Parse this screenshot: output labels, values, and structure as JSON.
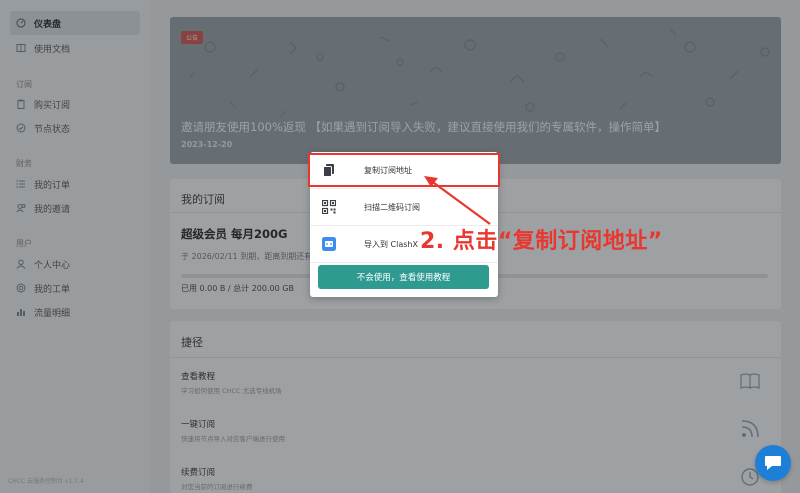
{
  "sidebar": {
    "items": [
      {
        "label": "仪表盘",
        "icon": "dashboard-icon",
        "active": true
      },
      {
        "label": "使用文档",
        "icon": "book-icon"
      },
      {
        "label": "购买订阅",
        "icon": "clipboard-icon"
      },
      {
        "label": "节点状态",
        "icon": "check-circle-icon"
      },
      {
        "label": "我的订单",
        "icon": "list-icon"
      },
      {
        "label": "我的邀请",
        "icon": "users-icon"
      },
      {
        "label": "个人中心",
        "icon": "user-icon"
      },
      {
        "label": "我的工单",
        "icon": "support-icon"
      },
      {
        "label": "流量明细",
        "icon": "bar-chart-icon"
      }
    ],
    "groups": {
      "subscribe": "订阅",
      "finance": "财务",
      "user": "用户"
    },
    "version": "CHCC 云服务控制台 v1.7.4"
  },
  "notice": {
    "tag": "公告",
    "title": "邀请朋友使用100%返现 【如果遇到订阅导入失败，建议直接使用我们的专属软件，操作简单】",
    "date": "2023-12-20"
  },
  "subscription": {
    "header": "我的订阅",
    "plan": "超级会员 每月200G",
    "expire_text": "于 2026/02/11 到期，距离到期还有 778 天。",
    "usage_text": "已用 0.00 B / 总计 200.00 GB",
    "usage_fraction": 0.0
  },
  "shortcuts": {
    "header": "捷径",
    "items": [
      {
        "title": "查看教程",
        "desc": "学习如何使用 CHCC 尤选专线机场",
        "icon": "book-open-icon"
      },
      {
        "title": "一键订阅",
        "desc": "快速将节点导入对应客户端进行使用",
        "icon": "rss-icon"
      },
      {
        "title": "续费订阅",
        "desc": "对您当前的订阅进行续费",
        "icon": "clock-icon"
      }
    ]
  },
  "popup": {
    "items": [
      {
        "label": "复制订阅地址",
        "icon": "copy-icon"
      },
      {
        "label": "扫描二维码订阅",
        "icon": "qrcode-icon"
      },
      {
        "label": "导入到 ClashX",
        "icon": "clashx-icon"
      }
    ],
    "help_button": "不会使用，查看使用教程"
  },
  "annotation": "2. 点击“复制订阅地址”",
  "colors": {
    "accent": "#2f9a90",
    "annotation": "#e8372e",
    "chat": "#1e7fd6"
  }
}
